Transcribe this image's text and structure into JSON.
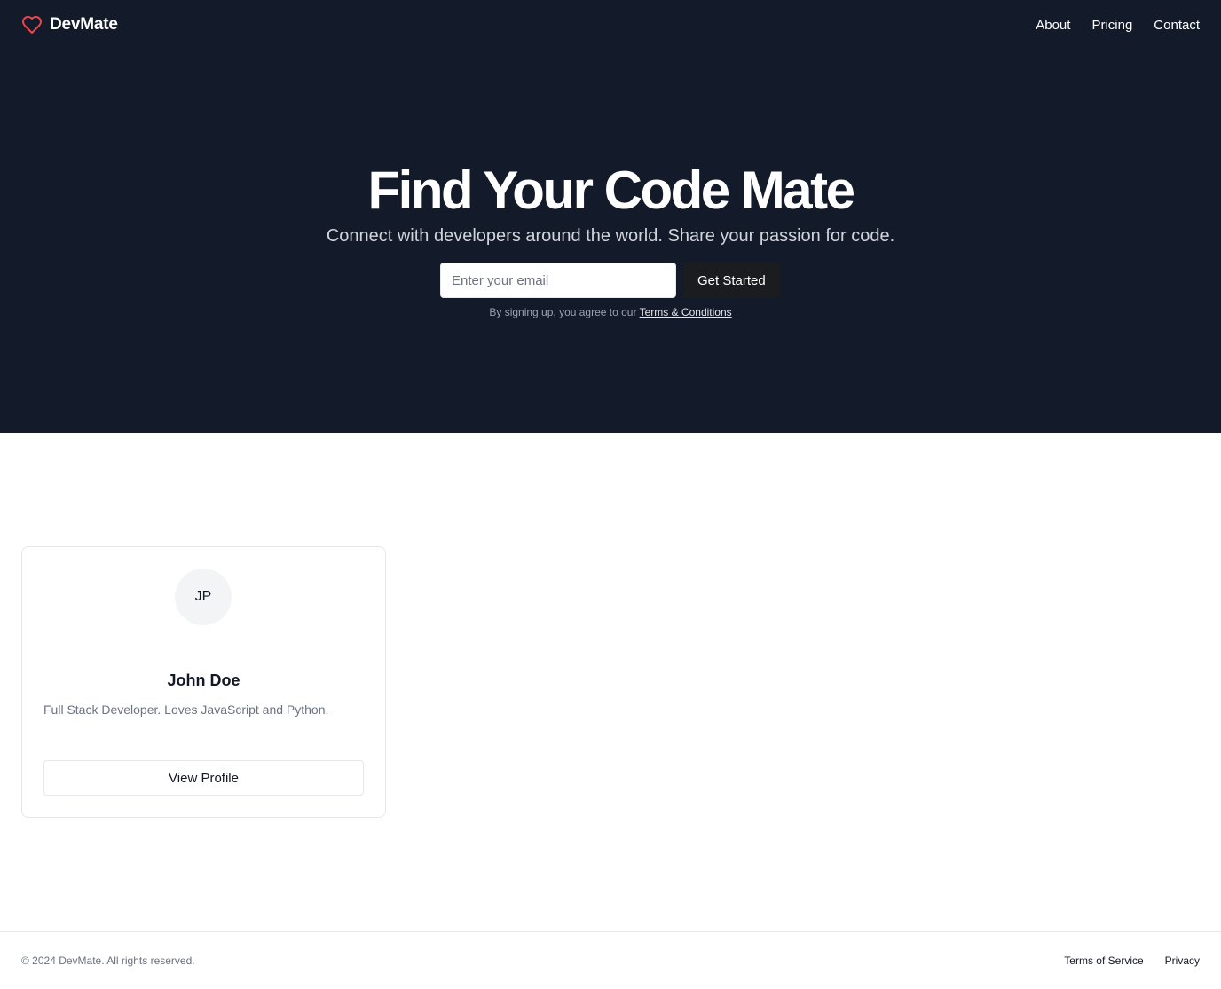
{
  "nav": {
    "brand": "DevMate",
    "brand_icon": "heart-icon",
    "brand_icon_color": "#ef4444",
    "links": [
      "About",
      "Pricing",
      "Contact"
    ]
  },
  "hero": {
    "title": "Find Your Code Mate",
    "subtitle": "Connect with developers around the world. Share your passion for code.",
    "email_placeholder": "Enter your email",
    "email_value": "",
    "cta_label": "Get Started",
    "legal_text": "By signing up, you agree to our",
    "legal_link": "Terms & Conditions",
    "background": "#131a29"
  },
  "profile_card": {
    "initials": "JP",
    "name": "John Doe",
    "bio": "Full Stack Developer. Loves JavaScript and Python.",
    "button_label": "View Profile"
  },
  "footer": {
    "copyright": "© 2024 DevMate. All rights reserved.",
    "links": [
      "Terms of Service",
      "Privacy"
    ]
  }
}
